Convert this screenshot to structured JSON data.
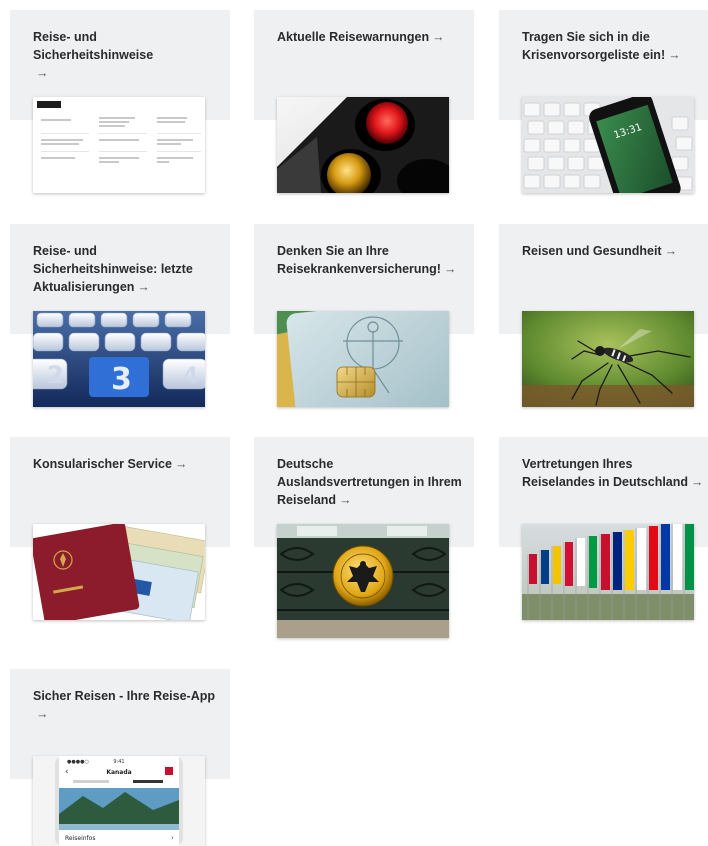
{
  "cards": [
    {
      "title": "Reise- und Sicherheitshinweise",
      "arrow": "→"
    },
    {
      "title": "Aktuelle Reisewarnungen",
      "arrow": "→"
    },
    {
      "title": "Tragen Sie sich in die Krisenvorsorgeliste ein!",
      "arrow": "→"
    },
    {
      "title": "Reise- und Sicherheitshinweise: letzte Aktualisierungen",
      "arrow": "→"
    },
    {
      "title": "Denken Sie an Ihre Reisekrankenversicherung!",
      "arrow": "→"
    },
    {
      "title": "Reisen und Gesundheit",
      "arrow": "→"
    },
    {
      "title": "Konsularischer Service",
      "arrow": "→"
    },
    {
      "title": "Deutsche Auslandsvertretungen in Ihrem Reiseland",
      "arrow": "→"
    },
    {
      "title": "Vertretungen Ihres Reiselandes in Deutschland",
      "arrow": "→"
    },
    {
      "title": "Sicher Reisen - Ihre Reise-App",
      "arrow": "→"
    }
  ],
  "app_preview": {
    "country": "Kanada",
    "time": "9:41",
    "detail_label": "Reiseinfos"
  },
  "phone_lock": {
    "time": "13:31"
  },
  "colors": {
    "panel": "#eef0f2",
    "title": "#2b2b2b",
    "passport": "#8c1c2b",
    "mosquito_bg": "#6f8f3a"
  }
}
